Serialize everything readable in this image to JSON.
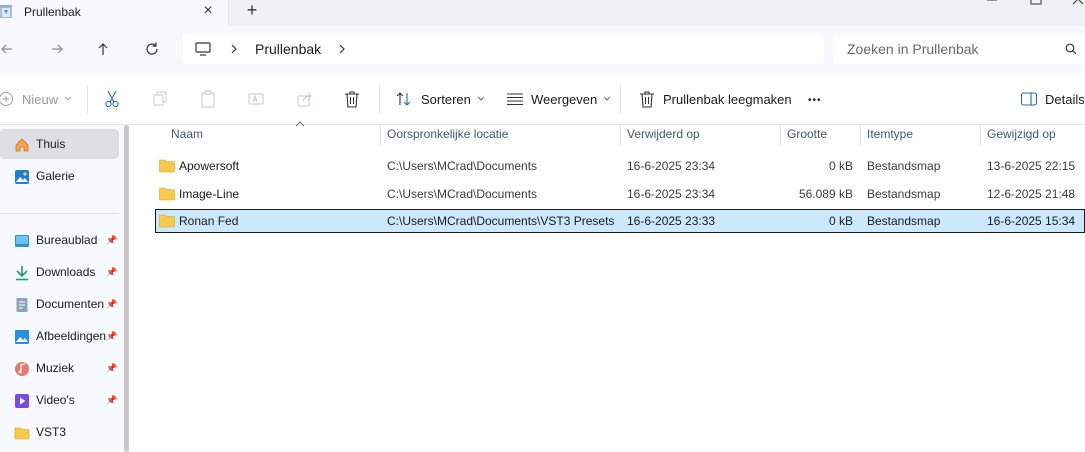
{
  "window": {
    "tab_title": "Prullenbak",
    "new_tab_symbol": "+",
    "close_symbol": "×"
  },
  "address": {
    "location": "Prullenbak",
    "search_placeholder": "Zoeken in Prullenbak"
  },
  "toolbar": {
    "new_label": "Nieuw",
    "sort_label": "Sorteren",
    "view_label": "Weergeven",
    "empty_bin_label": "Prullenbak leegmaken",
    "more_label": "•••",
    "details_label": "Details"
  },
  "sidebar": {
    "top_items": [
      {
        "label": "Thuis",
        "icon": "home-icon",
        "active": true
      },
      {
        "label": "Galerie",
        "icon": "gallery-icon",
        "active": false
      }
    ],
    "pinned_items": [
      {
        "label": "Bureaublad",
        "icon": "desktop-icon"
      },
      {
        "label": "Downloads",
        "icon": "download-icon"
      },
      {
        "label": "Documenten",
        "icon": "documents-icon"
      },
      {
        "label": "Afbeeldingen",
        "icon": "pictures-icon"
      },
      {
        "label": "Muziek",
        "icon": "music-icon"
      },
      {
        "label": "Video's",
        "icon": "videos-icon"
      },
      {
        "label": "VST3",
        "icon": "folder-icon"
      }
    ]
  },
  "table": {
    "columns": [
      "Naam",
      "Oorspronkelijke locatie",
      "Verwijderd op",
      "Grootte",
      "Itemtype",
      "Gewijzigd op"
    ],
    "rows": [
      {
        "name": "Apowersoft",
        "location": "C:\\Users\\MCrad\\Documents",
        "deleted": "16-6-2025 23:34",
        "size": "0 kB",
        "type": "Bestandsmap",
        "modified": "13-6-2025 22:15",
        "selected": false
      },
      {
        "name": "Image-Line",
        "location": "C:\\Users\\MCrad\\Documents",
        "deleted": "16-6-2025 23:34",
        "size": "56.089 kB",
        "type": "Bestandsmap",
        "modified": "12-6-2025 21:48",
        "selected": false
      },
      {
        "name": "Ronan Fed",
        "location": "C:\\Users\\MCrad\\Documents\\VST3 Presets",
        "deleted": "16-6-2025 23:33",
        "size": "0 kB",
        "type": "Bestandsmap",
        "modified": "16-6-2025 15:34",
        "selected": true
      }
    ]
  },
  "colors": {
    "accent": "#0067c0",
    "selected_row": "#cce8ff",
    "folder": "#f8c94b"
  }
}
